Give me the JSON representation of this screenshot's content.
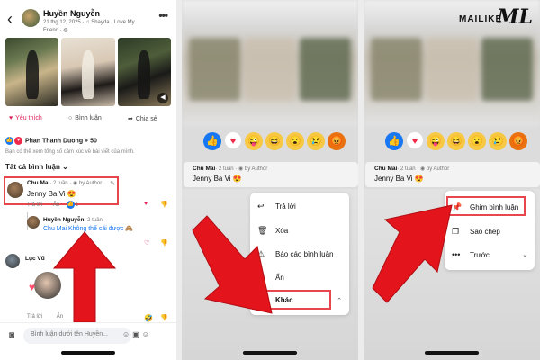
{
  "post": {
    "author": "Huyền Nguyễn",
    "date": "21 thg 12, 2025",
    "music": "Shayda · Love My",
    "audience": "Friend"
  },
  "post_actions": {
    "like": "Yêu thích",
    "comment": "Bình luận",
    "share": "Chia sẻ"
  },
  "reactions_summary": "Phan Thanh Duong + 50",
  "reactions_note": "Bạn có thể xem tổng số cảm xúc về bài viết của mình.",
  "comment_filter": "Tất cả bình luận",
  "comments": [
    {
      "name": "Chu Mai",
      "meta": "· 2 tuần · ",
      "badge": "by Author",
      "text": "Jenny Ba Vi 😍",
      "reply_label": "Trả lời",
      "hide_label": "Ẩn",
      "reply_count": "1"
    },
    {
      "name": "Huyền Nguyễn",
      "meta": "· 2 tuần ·",
      "text": "Chu Mai Không thể cãi được 🙈"
    },
    {
      "name": "Lục Vũ",
      "reply_label": "Trả lời",
      "hide_label": "Ẩn"
    }
  ],
  "composer": {
    "placeholder": "Bình luận dưới tên Huyền..."
  },
  "context_menu": {
    "items": [
      {
        "icon": "reply-icon",
        "label": "Trả lời"
      },
      {
        "icon": "trash-icon",
        "label": "Xóa"
      },
      {
        "icon": "report-icon",
        "label": "Báo cáo bình luận"
      },
      {
        "icon": "hide-icon",
        "label": "Ẩn"
      },
      {
        "icon": "more-icon",
        "label": "Khác"
      }
    ]
  },
  "more_menu": {
    "items": [
      {
        "icon": "pin-icon",
        "label": "Ghim bình luận"
      },
      {
        "icon": "copy-icon",
        "label": "Sao chép"
      },
      {
        "icon": "more-icon",
        "label": "Trước"
      }
    ]
  },
  "watermark": {
    "text": "MAILIKE",
    "mark": "ML"
  },
  "colors": {
    "highlight": "#e8464d",
    "arrow": "#e3141b",
    "facebook_blue": "#1877f2"
  }
}
